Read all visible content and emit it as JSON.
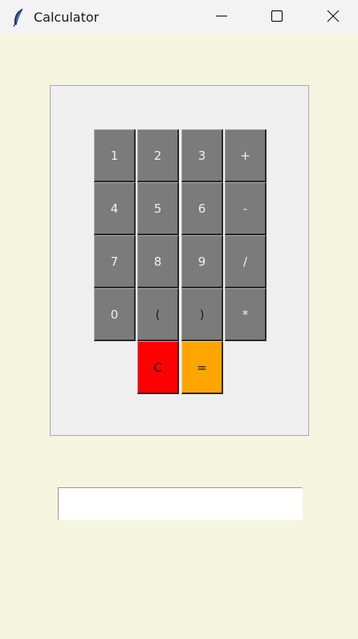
{
  "window": {
    "title": "Calculator",
    "icon": "feather-icon"
  },
  "keypad": {
    "rows": [
      [
        "1",
        "2",
        "3",
        "+"
      ],
      [
        "4",
        "5",
        "6",
        "-"
      ],
      [
        "7",
        "8",
        "9",
        "/"
      ],
      [
        "0",
        "(",
        ")",
        "*"
      ]
    ],
    "clear_label": "C",
    "equals_label": "="
  },
  "display": {
    "value": ""
  },
  "colors": {
    "background": "#f5f5df",
    "key": "#7b7b7b",
    "clear": "#ff0000",
    "equals": "#ffa500"
  }
}
